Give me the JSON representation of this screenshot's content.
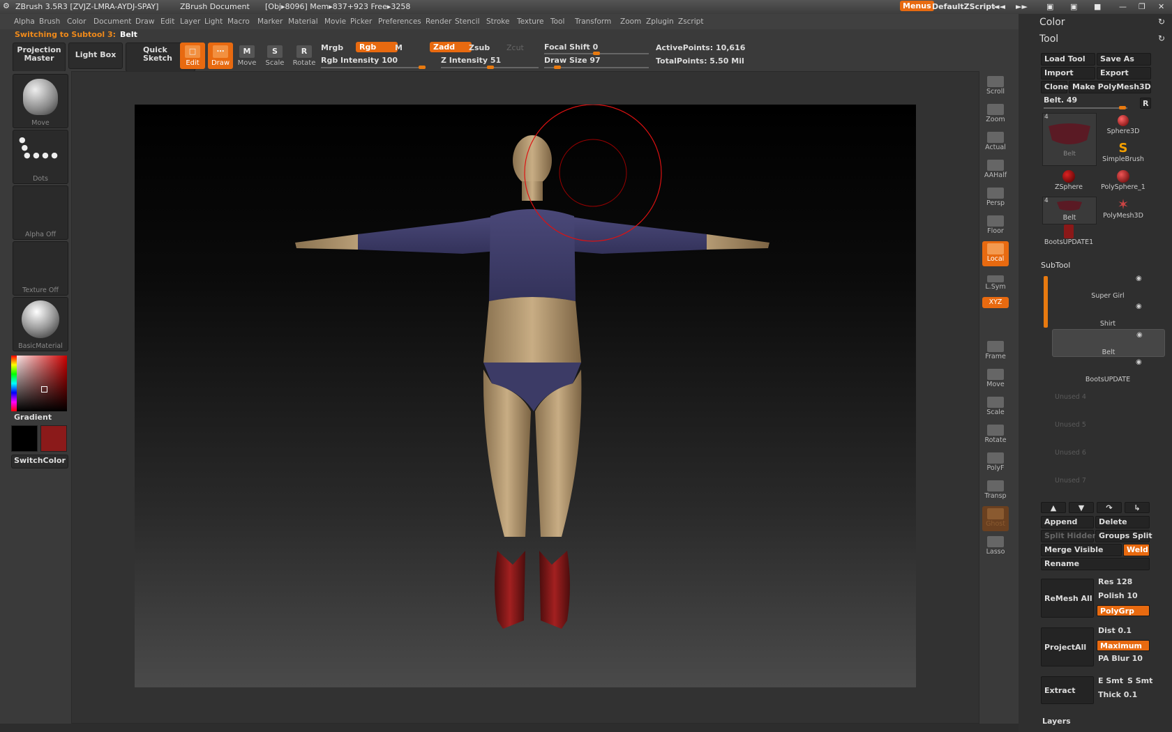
{
  "titlebar": {
    "app": "ZBrush 3.5R3 [ZVJZ-LMRA-AYDJ-SPAY]",
    "doc": "ZBrush Document",
    "stats": "[Obj▸8096] Mem▸837+923 Free▸3258",
    "menus_btn": "Menus",
    "script": "DefaultZScript"
  },
  "menubar": [
    "Alpha",
    "Brush",
    "Color",
    "Document",
    "Draw",
    "Edit",
    "Layer",
    "Light",
    "Macro",
    "Marker",
    "Material",
    "Movie",
    "Picker",
    "Preferences",
    "Render",
    "Stencil",
    "Stroke",
    "Texture",
    "Tool",
    "Transform",
    "Zoom",
    "Zplugin",
    "Zscript"
  ],
  "status": {
    "prefix": "Switching to Subtool 3:",
    "name": "Belt"
  },
  "toolbar": {
    "projection_master": "Projection Master",
    "light_box": "Light Box",
    "quick_sketch": "Quick Sketch",
    "edit": "Edit",
    "draw": "Draw",
    "move": "Move",
    "scale": "Scale",
    "rotate": "Rotate",
    "mrgb": "Mrgb",
    "rgb": "Rgb",
    "m": "M",
    "zadd": "Zadd",
    "zsub": "Zsub",
    "zcut": "Zcut",
    "rgb_intensity": "Rgb Intensity 100",
    "z_intensity": "Z Intensity 51",
    "focal_shift": "Focal Shift 0",
    "draw_size": "Draw Size 97",
    "active_points": "ActivePoints: 10,616",
    "total_points": "TotalPoints: 5.50 Mil",
    "rgb_intensity_value": 100,
    "z_intensity_value": 51,
    "focal_shift_value": 0,
    "draw_size_value": 97
  },
  "leftshelf": {
    "brush": "Move",
    "stroke": "Dots",
    "alpha": "Alpha Off",
    "texture": "Texture Off",
    "material": "BasicMaterial",
    "gradient": "Gradient",
    "switch_color": "SwitchColor",
    "color_main": "#000000",
    "color_secondary": "#8b1a1a"
  },
  "rightshelf": [
    "Scroll",
    "Zoom",
    "Actual",
    "AAHalf",
    "Persp",
    "Floor",
    "Local",
    "L.Sym",
    "XYZ",
    "Frame",
    "Move",
    "Scale",
    "Rotate",
    "PolyF",
    "Transp",
    "Ghost",
    "Lasso"
  ],
  "panel": {
    "color_title": "Color",
    "tool_title": "Tool",
    "load_tool": "Load Tool",
    "save_as": "Save As",
    "import": "Import",
    "export": "Export",
    "clone": "Clone",
    "make_polymesh": "Make PolyMesh3D",
    "belt_slider": "Belt. 49",
    "r_btn": "R",
    "tool_count": "4",
    "tools": [
      "Belt",
      "Sphere3D",
      "SimpleBrush",
      "ZSphere",
      "PolySphere_1",
      "Belt",
      "PolyMesh3D",
      "BootsUPDATE1"
    ],
    "subtool_title": "SubTool",
    "subtools": [
      "Super Girl",
      "Shirt",
      "Belt",
      "BootsUPDATE"
    ],
    "unused": [
      "Unused 4",
      "Unused 5",
      "Unused 6",
      "Unused 7"
    ],
    "append": "Append",
    "delete": "Delete",
    "split_hidden": "Split Hidden",
    "groups_split": "Groups Split",
    "merge_visible": "Merge Visible",
    "weld": "Weld",
    "rename": "Rename",
    "remesh_all": "ReMesh All",
    "res": "Res 128",
    "polish": "Polish 10",
    "polygrp": "PolyGrp",
    "project_all": "ProjectAll",
    "dist": "Dist 0.1",
    "maximum": "Maximum",
    "pa_blur": "PA Blur 10",
    "extract": "Extract",
    "e_smt": "E Smt",
    "s_smt": "S Smt",
    "thick": "Thick 0.1",
    "layers": "Layers"
  }
}
